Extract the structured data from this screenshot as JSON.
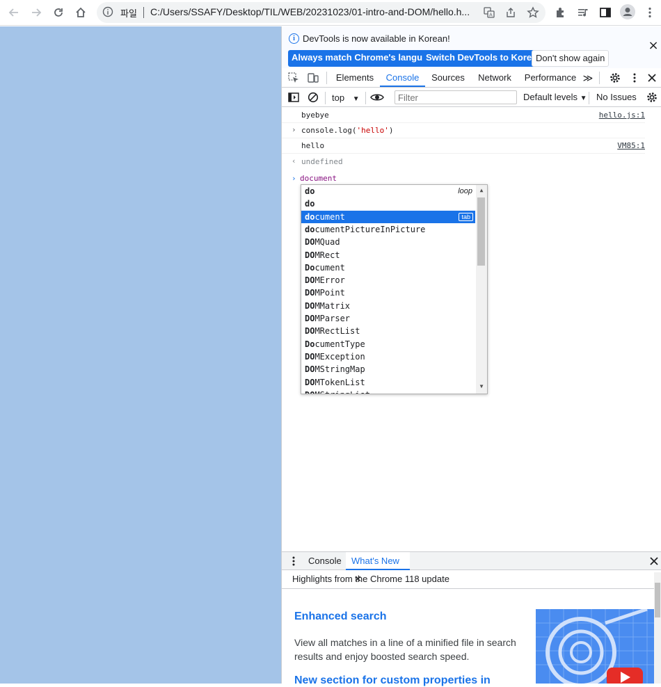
{
  "browser": {
    "scheme_label": "파일",
    "url": "C:/Users/SSAFY/Desktop/TIL/WEB/20231023/01-intro-and-DOM/hello.h..."
  },
  "infobar": {
    "message": "DevTools is now available in Korean!",
    "btn_match": "Always match Chrome's language",
    "btn_switch": "Switch DevTools to Korean",
    "btn_dont_show": "Don't show again"
  },
  "tabs": {
    "elements": "Elements",
    "console": "Console",
    "sources": "Sources",
    "network": "Network",
    "performance": "Performance",
    "more": "≫"
  },
  "filterbar": {
    "context": "top",
    "filter_placeholder": "Filter",
    "levels": "Default levels",
    "issues": "No Issues"
  },
  "console": {
    "lines": [
      {
        "text": "byebye",
        "source": "hello.js:1"
      },
      {
        "cmd_pre": "console.log(",
        "cmd_str": "'hello'",
        "cmd_post": ")"
      },
      {
        "text": "hello",
        "source": "VM85:1"
      },
      {
        "result": "undefined"
      }
    ],
    "input": "document"
  },
  "autocomplete": {
    "items": [
      {
        "bold": "do",
        "rest": "",
        "hint": "loop"
      },
      {
        "bold": "do",
        "rest": ""
      },
      {
        "bold": "do",
        "rest": "cument",
        "selected": true,
        "hint": "tab"
      },
      {
        "bold": "do",
        "rest": "cumentPictureInPicture"
      },
      {
        "bold": "DO",
        "rest": "MQuad"
      },
      {
        "bold": "DO",
        "rest": "MRect"
      },
      {
        "bold": "Do",
        "rest": "cument"
      },
      {
        "bold": "DO",
        "rest": "MError"
      },
      {
        "bold": "DO",
        "rest": "MPoint"
      },
      {
        "bold": "DO",
        "rest": "MMatrix"
      },
      {
        "bold": "DO",
        "rest": "MParser"
      },
      {
        "bold": "DO",
        "rest": "MRectList"
      },
      {
        "bold": "Do",
        "rest": "cumentType"
      },
      {
        "bold": "DO",
        "rest": "MException"
      },
      {
        "bold": "DO",
        "rest": "MStringMap"
      },
      {
        "bold": "DO",
        "rest": "MTokenList"
      },
      {
        "bold": "DO",
        "rest": "MStringList"
      }
    ]
  },
  "drawer": {
    "tab_console": "Console",
    "tab_whats_new": "What's New",
    "subheader": "Highlights from the Chrome 118 update",
    "item_title": "Enhanced search",
    "item_desc": "View all matches in a line of a minified file in search results and enjoy boosted search speed.",
    "next_title": "New section for custom properties in"
  },
  "colors": {
    "accent": "#1a73e8",
    "page_background": "#a4c4e8"
  }
}
